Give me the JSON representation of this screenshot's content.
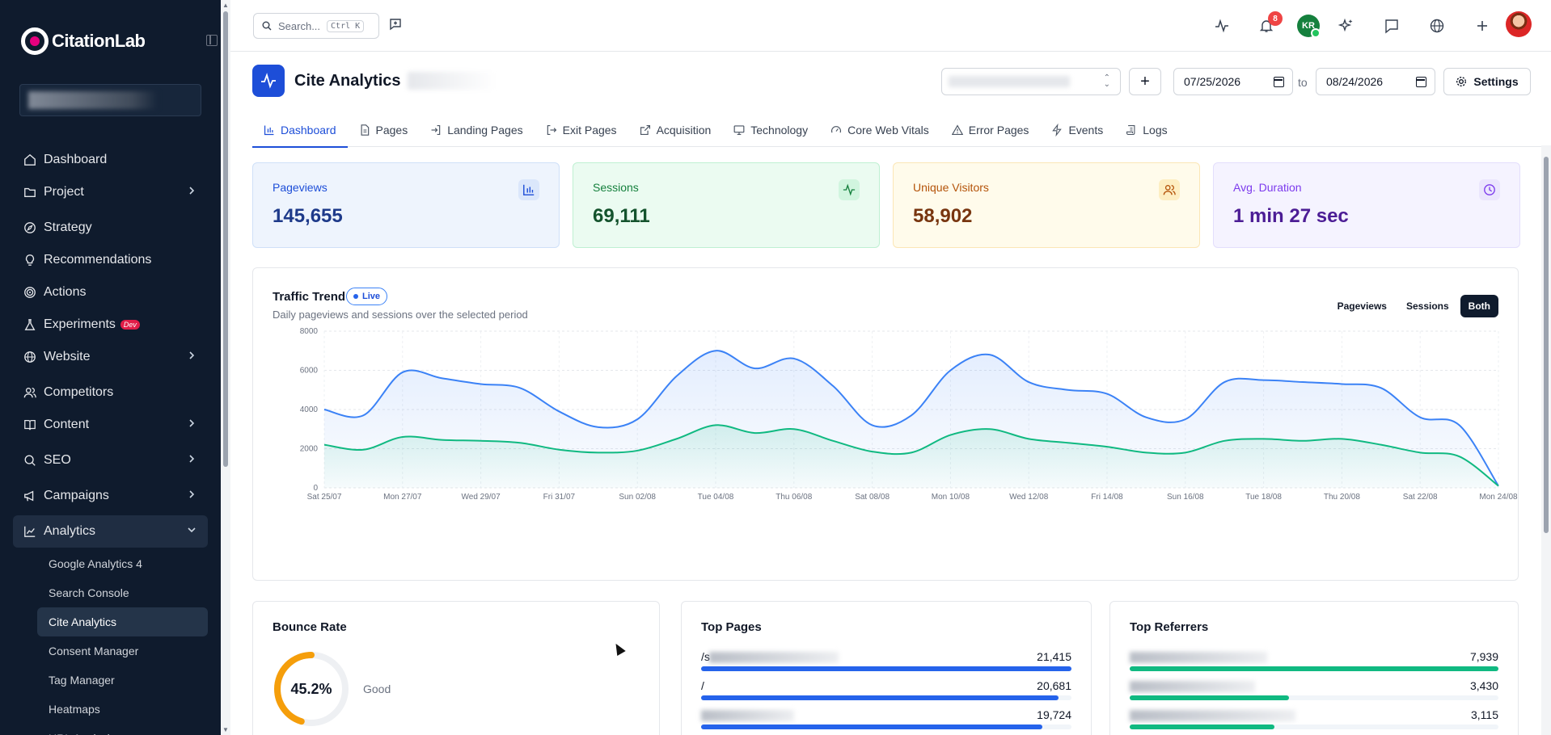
{
  "app": {
    "brand": "CitationLab"
  },
  "sidebar": {
    "items": [
      {
        "label": "Dashboard",
        "icon": "home-icon"
      },
      {
        "label": "Project",
        "icon": "folder-icon",
        "chevron": true
      },
      {
        "label": "Strategy",
        "icon": "compass-icon"
      },
      {
        "label": "Recommendations",
        "icon": "lightbulb-icon"
      },
      {
        "label": "Actions",
        "icon": "target-icon"
      },
      {
        "label": "Experiments",
        "icon": "flask-icon",
        "badge": "Dev"
      },
      {
        "label": "Website",
        "icon": "globe-icon",
        "chevron": true
      },
      {
        "label": "Competitors",
        "icon": "users-icon"
      },
      {
        "label": "Content",
        "icon": "book-icon",
        "chevron": true
      },
      {
        "label": "SEO",
        "icon": "search-icon",
        "chevron": true
      },
      {
        "label": "Campaigns",
        "icon": "megaphone-icon",
        "chevron": true
      },
      {
        "label": "Analytics",
        "icon": "chart-line-icon",
        "expanded": true
      }
    ],
    "subitems": [
      {
        "label": "Google Analytics 4"
      },
      {
        "label": "Search Console"
      },
      {
        "label": "Cite Analytics",
        "active": true
      },
      {
        "label": "Consent Manager"
      },
      {
        "label": "Tag Manager"
      },
      {
        "label": "Heatmaps"
      },
      {
        "label": "URL Analysis"
      }
    ]
  },
  "topbar": {
    "search_placeholder": "Search...",
    "shortcut": "Ctrl K",
    "notification_count": "8",
    "user_initials": "KR"
  },
  "header": {
    "title": "Cite Analytics",
    "date_from": "07/25/2026",
    "to_label": "to",
    "date_to": "08/24/2026",
    "settings_label": "Settings"
  },
  "tabs": [
    {
      "label": "Dashboard",
      "icon": "bar-chart-icon",
      "active": true
    },
    {
      "label": "Pages",
      "icon": "file-icon"
    },
    {
      "label": "Landing Pages",
      "icon": "log-in-icon"
    },
    {
      "label": "Exit Pages",
      "icon": "log-out-icon"
    },
    {
      "label": "Acquisition",
      "icon": "external-link-icon"
    },
    {
      "label": "Technology",
      "icon": "monitor-icon"
    },
    {
      "label": "Core Web Vitals",
      "icon": "gauge-icon"
    },
    {
      "label": "Error Pages",
      "icon": "alert-triangle-icon"
    },
    {
      "label": "Events",
      "icon": "zap-icon"
    },
    {
      "label": "Logs",
      "icon": "scroll-icon"
    }
  ],
  "kpis": [
    {
      "label": "Pageviews",
      "value": "145,655",
      "icon": "bar-chart-icon",
      "bg": "#eef4fd",
      "border": "#cfe0f8",
      "label_color": "#1d4ed8",
      "value_color": "#1e3a8a",
      "icon_bg": "#dbe7fb"
    },
    {
      "label": "Sessions",
      "value": "69,111",
      "icon": "activity-icon",
      "bg": "#ebfbf1",
      "border": "#bff0d2",
      "label_color": "#15803d",
      "value_color": "#14532d",
      "icon_bg": "#d1f5df"
    },
    {
      "label": "Unique Visitors",
      "value": "58,902",
      "icon": "users-icon",
      "bg": "#fffbeb",
      "border": "#fbe6b6",
      "label_color": "#b45309",
      "value_color": "#78350f",
      "icon_bg": "#fdeec2"
    },
    {
      "label": "Avg. Duration",
      "value": "1 min 27 sec",
      "icon": "clock-icon",
      "bg": "#f5f3ff",
      "border": "#e3defc",
      "label_color": "#7c3aed",
      "value_color": "#4c1d95",
      "icon_bg": "#ebe6fd"
    }
  ],
  "traffic": {
    "title": "Traffic Trend",
    "live_label": "Live",
    "subtitle": "Daily pageviews and sessions over the selected period",
    "toggle": [
      "Pageviews",
      "Sessions",
      "Both"
    ],
    "toggle_active": "Both"
  },
  "chart_data": {
    "type": "area",
    "x": [
      "Sat 25/07",
      "Sun 26/07",
      "Mon 27/07",
      "Tue 28/07",
      "Wed 29/07",
      "Thu 30/07",
      "Fri 31/07",
      "Sat 01/08",
      "Sun 02/08",
      "Mon 03/08",
      "Tue 04/08",
      "Wed 05/08",
      "Thu 06/08",
      "Fri 07/08",
      "Sat 08/08",
      "Sun 09/08",
      "Mon 10/08",
      "Tue 11/08",
      "Wed 12/08",
      "Thu 13/08",
      "Fri 14/08",
      "Sat 15/08",
      "Sun 16/08",
      "Mon 17/08",
      "Tue 18/08",
      "Wed 19/08",
      "Thu 20/08",
      "Fri 21/08",
      "Sat 22/08",
      "Sun 23/08",
      "Mon 24/08"
    ],
    "tick_labels": [
      "Sat 25/07",
      "Mon 27/07",
      "Wed 29/07",
      "Fri 31/07",
      "Sun 02/08",
      "Tue 04/08",
      "Thu 06/08",
      "Sat 08/08",
      "Mon 10/08",
      "Wed 12/08",
      "Fri 14/08",
      "Sun 16/08",
      "Tue 18/08",
      "Thu 20/08",
      "Sat 22/08",
      "Mon 24/08"
    ],
    "series": [
      {
        "color": "#3b82f6",
        "values": [
          4000,
          3700,
          5900,
          5600,
          5300,
          5100,
          3900,
          3100,
          3500,
          5700,
          7000,
          6100,
          6600,
          5200,
          3200,
          3700,
          6000,
          6800,
          5400,
          5000,
          4800,
          3600,
          3500,
          5400,
          5500,
          5400,
          5300,
          5100,
          3600,
          3200,
          100
        ]
      },
      {
        "color": "#10b981",
        "values": [
          2200,
          1950,
          2600,
          2450,
          2400,
          2300,
          1950,
          1800,
          1900,
          2500,
          3200,
          2800,
          3000,
          2400,
          1850,
          1800,
          2700,
          3000,
          2500,
          2300,
          2100,
          1800,
          1800,
          2400,
          2500,
          2400,
          2500,
          2200,
          1800,
          1600,
          100
        ]
      }
    ],
    "ylim": [
      0,
      8000
    ],
    "yticks": [
      0,
      2000,
      4000,
      6000,
      8000
    ],
    "grid": true
  },
  "bounce": {
    "title": "Bounce Rate",
    "value": "45.2%",
    "rating": "Good",
    "fraction": 0.452,
    "color": "#f59e0b"
  },
  "top_pages": {
    "title": "Top Pages",
    "rows": [
      {
        "name": "/s",
        "blurred": true,
        "value": "21,415",
        "fraction": 1.0
      },
      {
        "name": "/",
        "blurred": false,
        "value": "20,681",
        "fraction": 0.966
      },
      {
        "name": "",
        "blurred": true,
        "value": "19,724",
        "fraction": 0.921
      }
    ],
    "color": "#2563eb"
  },
  "top_referrers": {
    "title": "Top Referrers",
    "rows": [
      {
        "value": "7,939",
        "fraction": 1.0
      },
      {
        "value": "3,430",
        "fraction": 0.432
      },
      {
        "value": "3,115",
        "fraction": 0.392
      }
    ],
    "color": "#10b981"
  }
}
